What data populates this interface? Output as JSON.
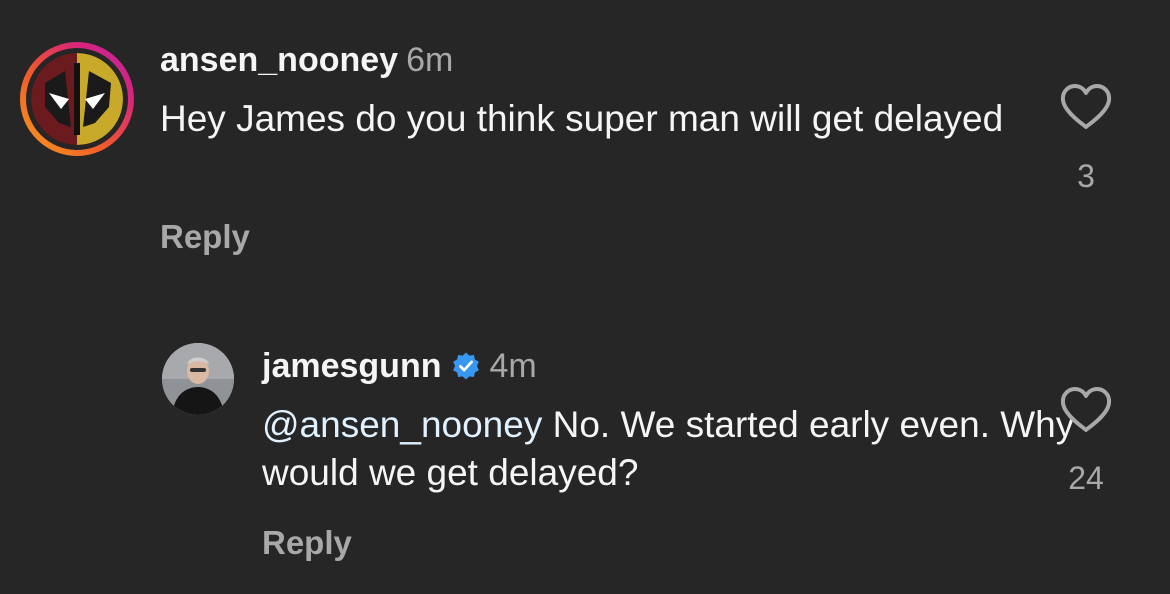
{
  "comments": [
    {
      "username": "ansen_nooney",
      "time": "6m",
      "text": "Hey James do you think super man will get delayed",
      "reply_label": "Reply",
      "likes": "3"
    }
  ],
  "replies": [
    {
      "username": "jamesgunn",
      "verified": true,
      "time": "4m",
      "mention": "@ansen_nooney",
      "text": " No. We started early even. Why would we get delayed?",
      "reply_label": "Reply",
      "likes": "24"
    }
  ],
  "colors": {
    "background": "#262626",
    "verified_badge": "#3897f0",
    "mention": "#e0f1ff",
    "secondary_text": "#a8a8a8"
  },
  "icons": [
    "heart-outline-icon",
    "verified-badge-icon"
  ]
}
